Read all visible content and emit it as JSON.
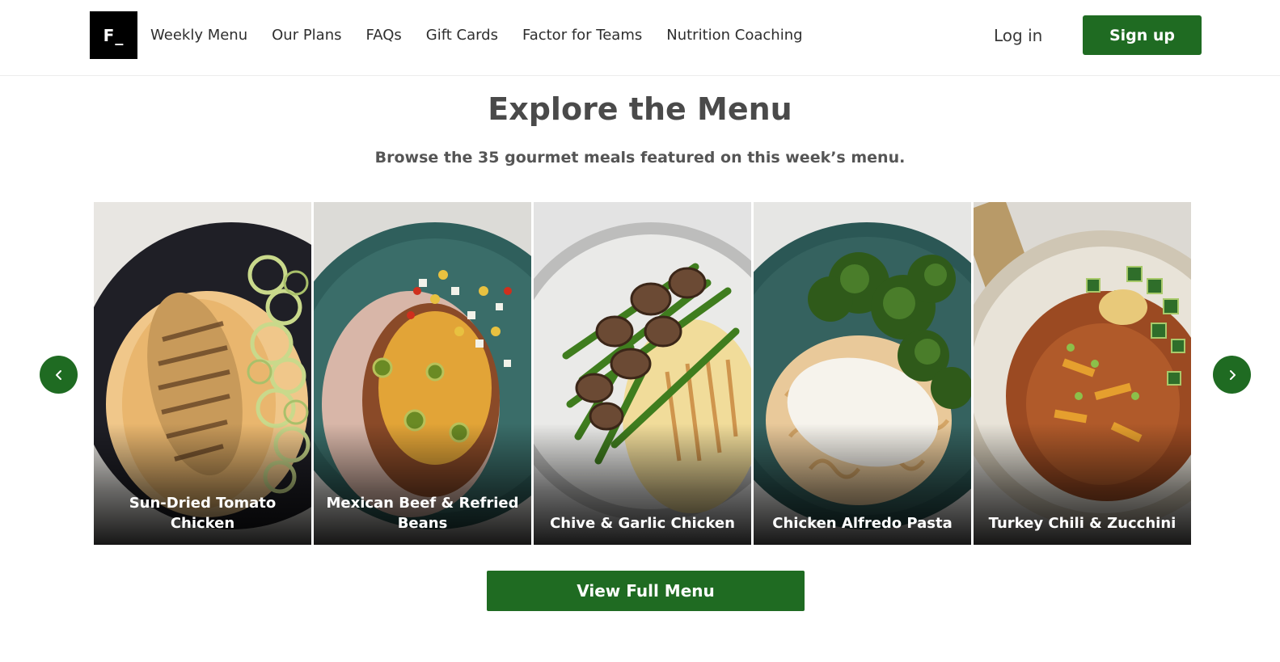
{
  "header": {
    "logo_text": "F_",
    "nav": [
      "Weekly Menu",
      "Our Plans",
      "FAQs",
      "Gift Cards",
      "Factor for Teams",
      "Nutrition Coaching"
    ],
    "login_label": "Log in",
    "signup_label": "Sign up"
  },
  "main": {
    "title": "Explore the Menu",
    "subtitle": "Browse the 35 gourmet meals featured on this week’s menu.",
    "meals": [
      {
        "name": "Sun-Dried Tomato Chicken"
      },
      {
        "name": "Mexican Beef & Refried Beans"
      },
      {
        "name": "Chive & Garlic Chicken"
      },
      {
        "name": "Chicken Alfredo Pasta"
      },
      {
        "name": "Turkey Chili & Zucchini"
      }
    ],
    "view_full_menu_label": "View Full Menu"
  },
  "colors": {
    "brand_green": "#1f6b22",
    "text_dark": "#404040"
  },
  "icons": {
    "prev": "chevron-left-icon",
    "next": "chevron-right-icon"
  }
}
